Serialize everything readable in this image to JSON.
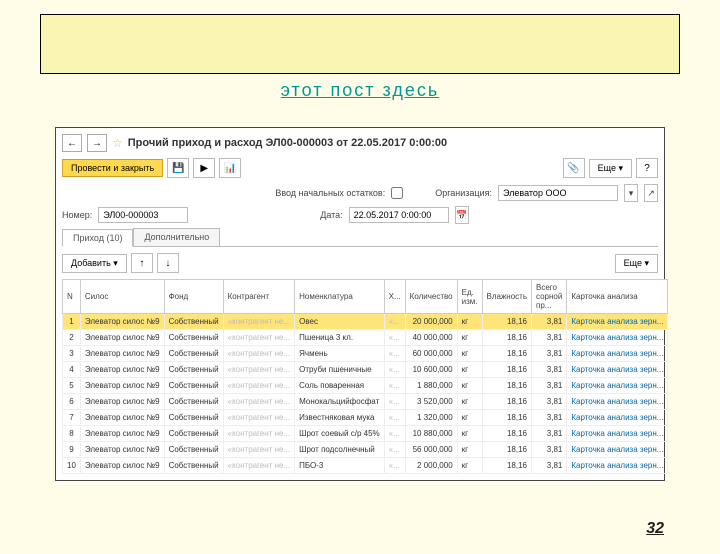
{
  "linkText": "этот пост здесь",
  "header": {
    "star": "☆",
    "title": "Прочий приход и расход ЭЛ00-000003 от 22.05.2017 0:00:00",
    "backArrow": "←",
    "fwdArrow": "→"
  },
  "toolbar": {
    "postClose": "Провести и закрыть",
    "more": "Еще",
    "help": "?"
  },
  "form": {
    "balanceLabel": "Ввод начальных остатков:",
    "orgLabel": "Организация:",
    "orgValue": "Элеватор ООО",
    "numberLabel": "Номер:",
    "numberValue": "ЭЛ00-000003",
    "dateLabel": "Дата:",
    "dateValue": "22.05.2017 0:00:00"
  },
  "tabs": {
    "tab1": "Приход (10)",
    "tab2": "Дополнительно"
  },
  "tableToolbar": {
    "add": "Добавить"
  },
  "columns": [
    "N",
    "Силос",
    "Фонд",
    "Контрагент",
    "Номенклатура",
    "Х...",
    "Количество",
    "Ед. изм.",
    "Влажность",
    "Всего сорной пр...",
    "Карточка анализа"
  ],
  "rows": [
    {
      "n": "1",
      "silo": "Элеватор силос №9",
      "fund": "Собственный",
      "contr": "«контрагент не...",
      "nom": "Овес",
      "x": "«...",
      "qty": "20 000,000",
      "uom": "кг",
      "hum": "18,16",
      "sor": "3,81",
      "card": "Карточка анализа зерн..."
    },
    {
      "n": "2",
      "silo": "Элеватор силос №9",
      "fund": "Собственный",
      "contr": "«контрагент не...",
      "nom": "Пшеница 3 кл.",
      "x": "«...",
      "qty": "40 000,000",
      "uom": "кг",
      "hum": "18,16",
      "sor": "3,81",
      "card": "Карточка анализа зерн..."
    },
    {
      "n": "3",
      "silo": "Элеватор силос №9",
      "fund": "Собственный",
      "contr": "«контрагент не...",
      "nom": "Ячмень",
      "x": "«...",
      "qty": "60 000,000",
      "uom": "кг",
      "hum": "18,16",
      "sor": "3,81",
      "card": "Карточка анализа зерн..."
    },
    {
      "n": "4",
      "silo": "Элеватор силос №9",
      "fund": "Собственный",
      "contr": "«контрагент не...",
      "nom": "Отруби пшеничные",
      "x": "«...",
      "qty": "10 600,000",
      "uom": "кг",
      "hum": "18,16",
      "sor": "3,81",
      "card": "Карточка анализа зерн..."
    },
    {
      "n": "5",
      "silo": "Элеватор силос №9",
      "fund": "Собственный",
      "contr": "«контрагент не...",
      "nom": "Соль поваренная",
      "x": "«...",
      "qty": "1 880,000",
      "uom": "кг",
      "hum": "18,16",
      "sor": "3,81",
      "card": "Карточка анализа зерн..."
    },
    {
      "n": "6",
      "silo": "Элеватор силос №9",
      "fund": "Собственный",
      "contr": "«контрагент не...",
      "nom": "Монокальцийфосфат",
      "x": "«...",
      "qty": "3 520,000",
      "uom": "кг",
      "hum": "18,16",
      "sor": "3,81",
      "card": "Карточка анализа зерн..."
    },
    {
      "n": "7",
      "silo": "Элеватор силос №9",
      "fund": "Собственный",
      "contr": "«контрагент не...",
      "nom": "Известняковая мука",
      "x": "«...",
      "qty": "1 320,000",
      "uom": "кг",
      "hum": "18,16",
      "sor": "3,81",
      "card": "Карточка анализа зерн..."
    },
    {
      "n": "8",
      "silo": "Элеватор силос №9",
      "fund": "Собственный",
      "contr": "«контрагент не...",
      "nom": "Шрот соевый с/р 45%",
      "x": "«...",
      "qty": "10 880,000",
      "uom": "кг",
      "hum": "18,16",
      "sor": "3,81",
      "card": "Карточка анализа зерн..."
    },
    {
      "n": "9",
      "silo": "Элеватор силос №9",
      "fund": "Собственный",
      "contr": "«контрагент не...",
      "nom": "Шрот подсолнечный",
      "x": "«...",
      "qty": "56 000,000",
      "uom": "кг",
      "hum": "18,16",
      "sor": "3,81",
      "card": "Карточка анализа зерн..."
    },
    {
      "n": "10",
      "silo": "Элеватор силос №9",
      "fund": "Собственный",
      "contr": "«контрагент не...",
      "nom": "ПБО-3",
      "x": "«...",
      "qty": "2 000,000",
      "uom": "кг",
      "hum": "18,16",
      "sor": "3,81",
      "card": "Карточка анализа зерн..."
    }
  ],
  "pageNumber": "32"
}
